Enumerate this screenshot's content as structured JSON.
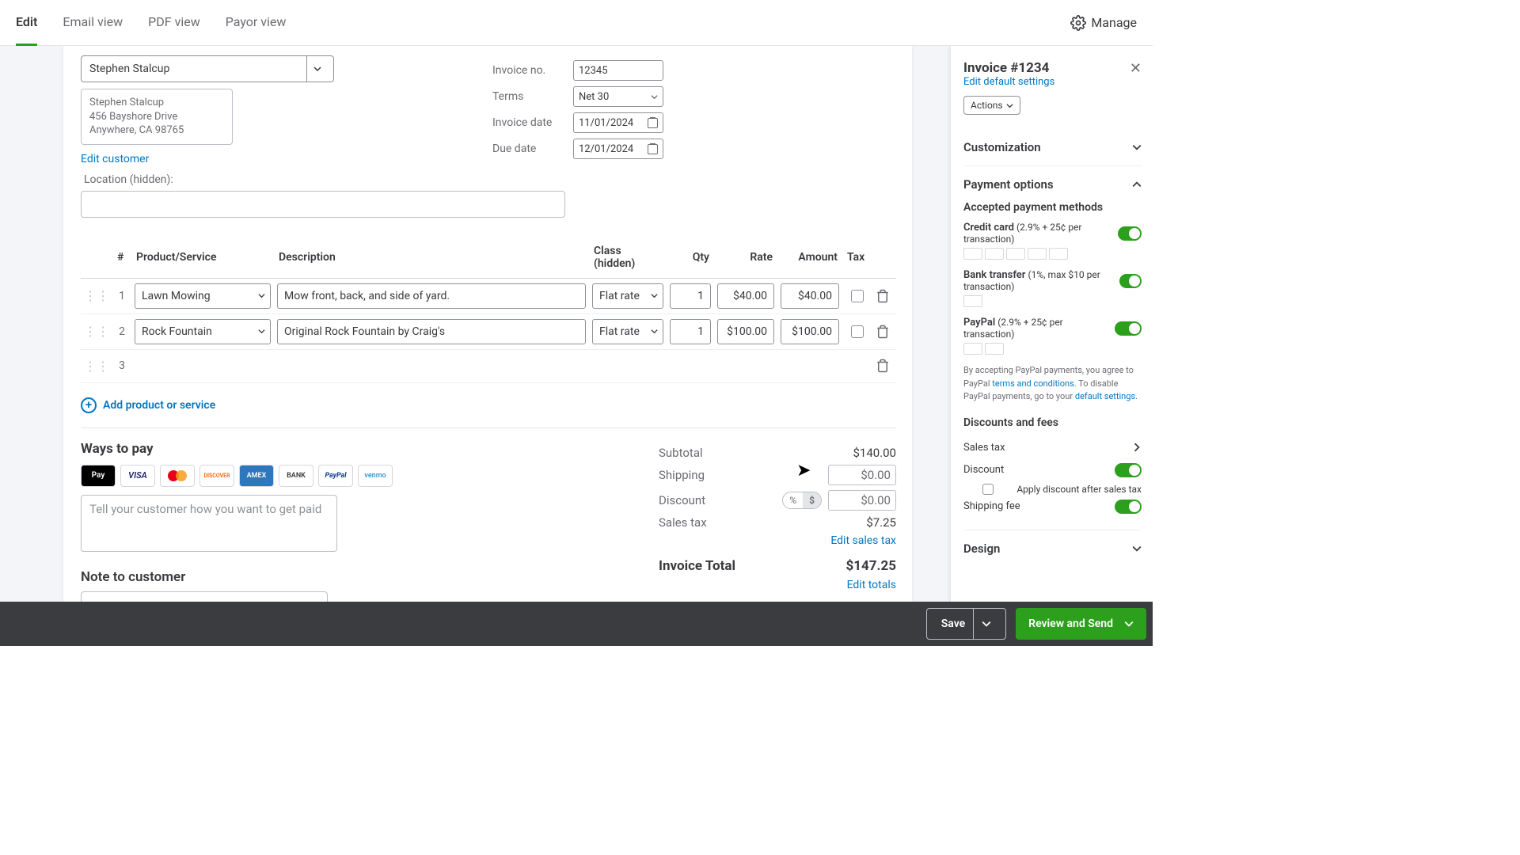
{
  "tabs": {
    "edit": "Edit",
    "email": "Email view",
    "pdf": "PDF view",
    "payor": "Payor view"
  },
  "manage": "Manage",
  "customer": {
    "selected": "Stephen Stalcup",
    "address": {
      "name": "Stephen Stalcup",
      "line1": "456 Bayshore Drive",
      "line2": "Anywhere, CA 98765"
    },
    "edit": "Edit customer"
  },
  "meta": {
    "invoice_no_label": "Invoice no.",
    "invoice_no": "12345",
    "terms_label": "Terms",
    "terms": "Net 30",
    "invoice_date_label": "Invoice date",
    "invoice_date": "11/01/2024",
    "due_date_label": "Due date",
    "due_date": "12/01/2024"
  },
  "location_label": "Location (hidden):",
  "columns": {
    "num": "#",
    "prod": "Product/Service",
    "desc": "Description",
    "klass": "Class (hidden)",
    "qty": "Qty",
    "rate": "Rate",
    "amount": "Amount",
    "tax": "Tax"
  },
  "items": [
    {
      "n": "1",
      "prod": "Lawn Mowing",
      "desc": "Mow front, back, and side of yard.",
      "klass": "Flat rate",
      "qty": "1",
      "rate": "$40.00",
      "amount": "$40.00"
    },
    {
      "n": "2",
      "prod": "Rock Fountain",
      "desc": "Original Rock Fountain by Craig's",
      "klass": "Flat rate",
      "qty": "1",
      "rate": "$100.00",
      "amount": "$100.00"
    },
    {
      "n": "3"
    }
  ],
  "add_product": "Add product or service",
  "ways_to_pay": "Ways to pay",
  "pay_placeholder": "Tell your customer how you want to get paid",
  "note_title": "Note to customer",
  "pay_icons": {
    "apay": "Pay",
    "visa": "VISA",
    "disc": "DISCOVER",
    "amex": "AMEX",
    "bank": "BANK",
    "pp": "PayPal",
    "venmo": "venmo"
  },
  "totals": {
    "subtotal_label": "Subtotal",
    "subtotal": "$140.00",
    "shipping_label": "Shipping",
    "shipping": "$0.00",
    "discount_label": "Discount",
    "discount": "$0.00",
    "pct": "%",
    "dollar": "$",
    "tax_label": "Sales tax",
    "tax": "$7.25",
    "edit_tax": "Edit sales tax",
    "total_label": "Invoice Total",
    "total": "$147.25",
    "edit_totals": "Edit totals"
  },
  "sidebar": {
    "title": "Invoice #1234",
    "sub": "Edit default settings",
    "actions": "Actions",
    "customization": "Customization",
    "payment_options": "Payment options",
    "apm": "Accepted payment methods",
    "cc": "Credit card",
    "cc_fee": "(2.9% + 25¢ per transaction)",
    "bt": "Bank transfer",
    "bt_fee": "(1%, max $10 per transaction)",
    "pp": "PayPal",
    "pp_fee": "(2.9% + 25¢ per transaction)",
    "pp_note_1": "By accepting PayPal payments, you agree to PayPal ",
    "pp_terms": "terms and conditions",
    "pp_note_2": ". To disable PayPal payments, go to your ",
    "pp_default": "default settings",
    "df": "Discounts and fees",
    "sales_tax": "Sales tax",
    "discount": "Discount",
    "apply_after": "Apply discount after sales tax",
    "ship": "Shipping fee",
    "design": "Design"
  },
  "footer": {
    "save": "Save",
    "send": "Review and Send"
  }
}
